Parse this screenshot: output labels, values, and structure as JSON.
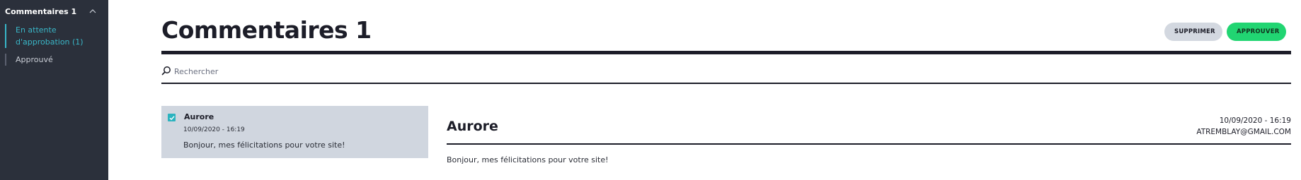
{
  "sidebar": {
    "header": "Commentaires 1",
    "items": [
      {
        "label": "En attente d'approbation (1)"
      },
      {
        "label": "Approuvé"
      }
    ]
  },
  "page": {
    "title": "Commentaires 1",
    "delete_label": "SUPPRIMER",
    "approve_label": "APPROUVER"
  },
  "search": {
    "placeholder": "Rechercher",
    "value": ""
  },
  "comments": [
    {
      "author": "Aurore",
      "date": "10/09/2020 - 16:19",
      "text": "Bonjour, mes félicitations pour votre site!",
      "checked": true
    }
  ],
  "detail": {
    "author": "Aurore",
    "date": "10/09/2020 - 16:19",
    "email": "ATREMBLAY@GMAIL.COM",
    "text": "Bonjour, mes félicitations pour votre site!"
  },
  "colors": {
    "sidebar_bg": "#2b303b",
    "accent_teal": "#38b6c8",
    "approve_green": "#21d572",
    "delete_gray": "#d3d8e0",
    "selected_row": "#d0d6df"
  },
  "icons": {
    "sidebar_toggle": "chevron-up-icon",
    "search": "search-icon",
    "checkbox": "checkmark-icon"
  }
}
